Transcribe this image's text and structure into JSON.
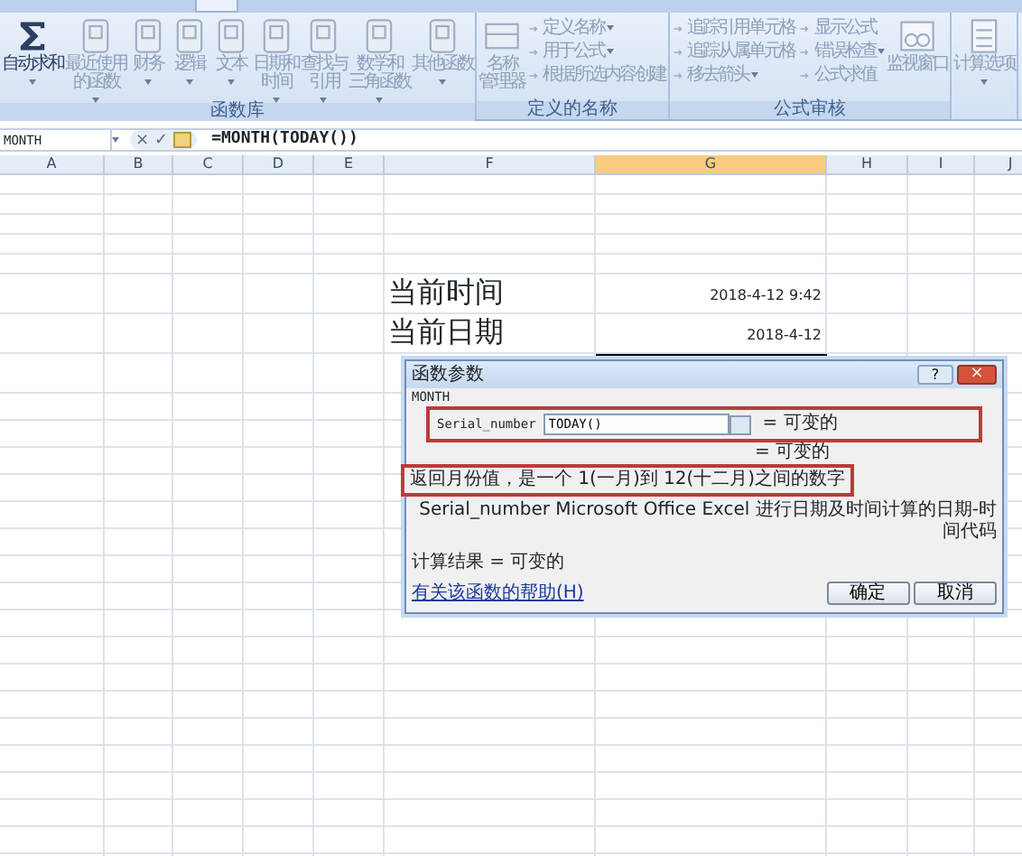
{
  "ribbon": {
    "groups": [
      {
        "label": "函数库",
        "items": [
          {
            "kind": "large",
            "label_lines": [
              "自动求和"
            ],
            "dropdown": true,
            "disabled": false
          },
          {
            "kind": "large",
            "label_lines": [
              "最近使用",
              "的函数"
            ],
            "dropdown": true,
            "disabled": true
          },
          {
            "kind": "large",
            "label_lines": [
              "财务"
            ],
            "dropdown": true,
            "disabled": true
          },
          {
            "kind": "large",
            "label_lines": [
              "逻辑"
            ],
            "dropdown": true,
            "disabled": true
          },
          {
            "kind": "large",
            "label_lines": [
              "文本"
            ],
            "dropdown": true,
            "disabled": true
          },
          {
            "kind": "large",
            "label_lines": [
              "日期和",
              "时间"
            ],
            "dropdown": true,
            "disabled": true
          },
          {
            "kind": "large",
            "label_lines": [
              "查找与",
              "引用"
            ],
            "dropdown": true,
            "disabled": true
          },
          {
            "kind": "large",
            "label_lines": [
              "数学和",
              "三角函数"
            ],
            "dropdown": true,
            "disabled": true
          },
          {
            "kind": "large",
            "label_lines": [
              "其他函数"
            ],
            "dropdown": true,
            "disabled": true
          }
        ]
      },
      {
        "label": "定义的名称",
        "items": [
          {
            "kind": "large",
            "label_lines": [
              "名称",
              "管理器"
            ],
            "dropdown": false,
            "disabled": true
          },
          {
            "kind": "small",
            "label": "定义名称",
            "dropdown": true,
            "disabled": true
          },
          {
            "kind": "small",
            "label": "用于公式",
            "dropdown": true,
            "disabled": true
          },
          {
            "kind": "small",
            "label": "根据所选内容创建",
            "dropdown": false,
            "disabled": true
          }
        ]
      },
      {
        "label": "公式审核",
        "items": [
          {
            "kind": "small",
            "label": "追踪引用单元格",
            "dropdown": false,
            "disabled": true
          },
          {
            "kind": "small",
            "label": "追踪从属单元格",
            "dropdown": false,
            "disabled": true
          },
          {
            "kind": "small",
            "label": "移去箭头",
            "dropdown": true,
            "disabled": true
          },
          {
            "kind": "small",
            "label": "显示公式",
            "dropdown": false,
            "disabled": true
          },
          {
            "kind": "small",
            "label": "错误检查",
            "dropdown": true,
            "disabled": true
          },
          {
            "kind": "small",
            "label": "公式求值",
            "dropdown": false,
            "disabled": true
          },
          {
            "kind": "large",
            "label_lines": [
              "监视窗口"
            ],
            "dropdown": false,
            "disabled": true
          }
        ]
      },
      {
        "items": [
          {
            "kind": "large",
            "label_lines": [
              "计算选项"
            ],
            "dropdown": true,
            "disabled": true
          }
        ]
      }
    ]
  },
  "formula_bar": {
    "name_box": "MONTH",
    "cancel": "×",
    "enter": "✓",
    "formula": "=MONTH(TODAY())"
  },
  "sheet": {
    "columns": [
      {
        "label": "A",
        "selected": false
      },
      {
        "label": "B",
        "selected": false
      },
      {
        "label": "C",
        "selected": false
      },
      {
        "label": "D",
        "selected": false
      },
      {
        "label": "E",
        "selected": false
      },
      {
        "label": "F",
        "selected": false
      },
      {
        "label": "G",
        "selected": true
      },
      {
        "label": "H",
        "selected": false
      },
      {
        "label": "I",
        "selected": false
      },
      {
        "label": "J",
        "selected": false
      }
    ],
    "rows": [
      {
        "label": "当前时间",
        "value": "2018-4-12 9:42",
        "selected": false
      },
      {
        "label": "当前日期",
        "value": "2018-4-12",
        "selected": false
      },
      {
        "selected": true
      }
    ]
  },
  "dialog": {
    "title": "函数参数",
    "help": "?",
    "close": "×",
    "function_name": "MONTH",
    "argument": {
      "label": "Serial_number",
      "value": "TODAY()",
      "result": "= 可变的"
    },
    "function_result": "= 可变的",
    "description": "返回月份值，是一个 1(一月)到 12(十二月)之间的数字",
    "argument_help": "Serial_number  Microsoft Office Excel 进行日期及时间计算的日期-时间代码",
    "formula_result": "计算结果 = 可变的",
    "help_link": "有关该函数的帮助(H)",
    "buttons": [
      "确定",
      "取消"
    ]
  }
}
